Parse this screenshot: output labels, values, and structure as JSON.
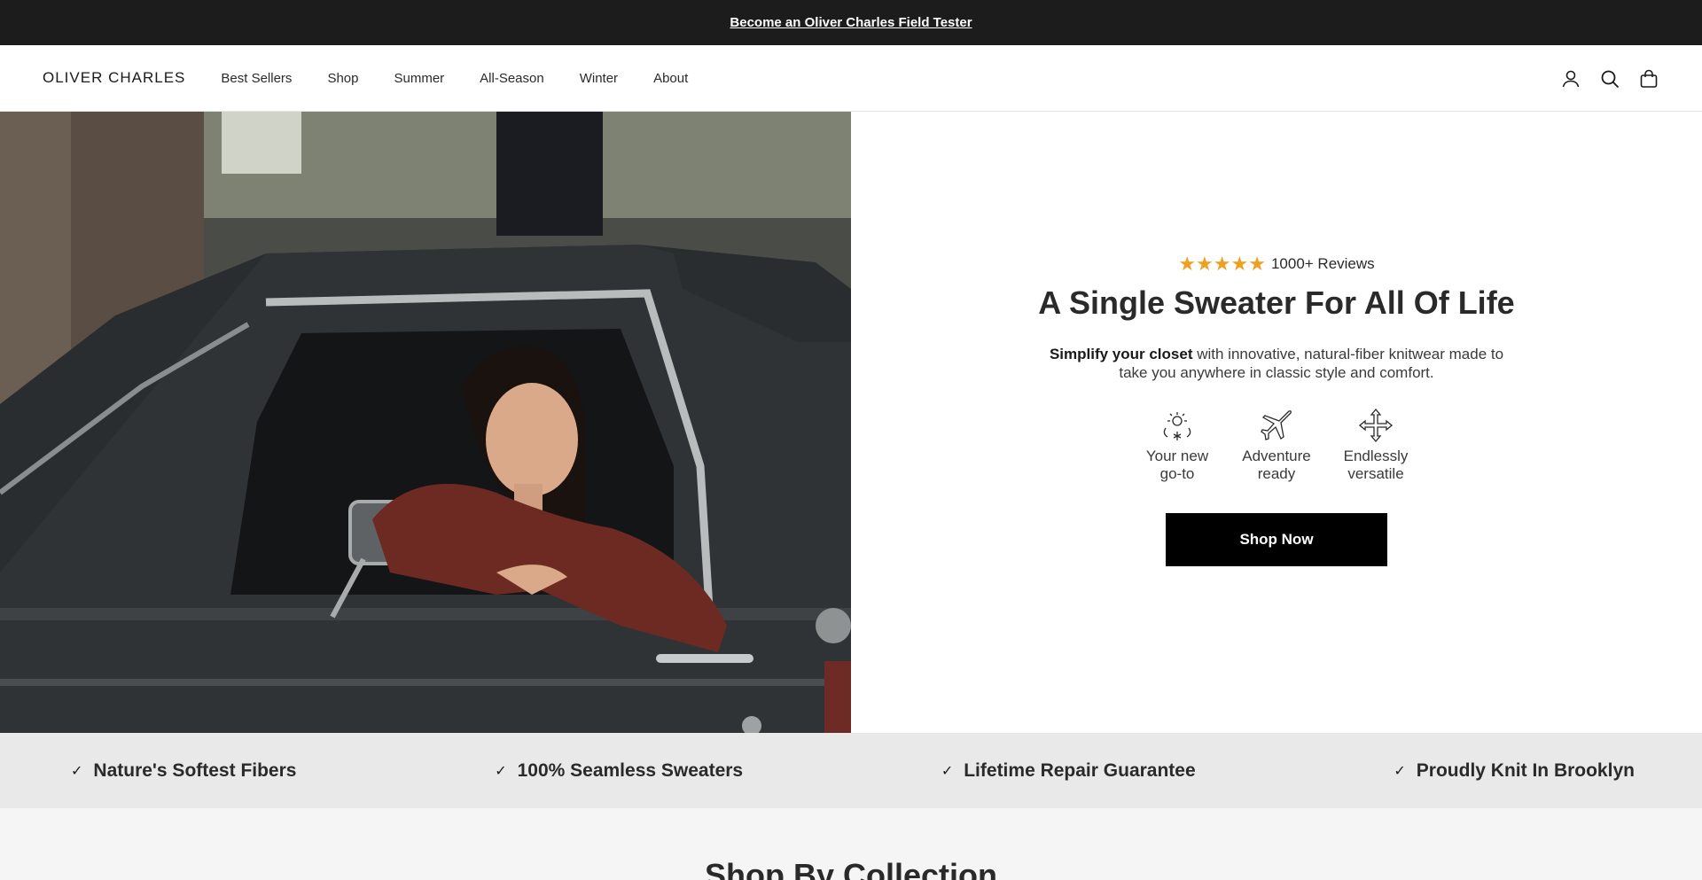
{
  "announcement": {
    "text": "Become an Oliver Charles Field Tester"
  },
  "header": {
    "logo": "OLIVER CHARLES",
    "nav": [
      "Best Sellers",
      "Shop",
      "Summer",
      "All-Season",
      "Winter",
      "About"
    ],
    "icons": [
      "account-icon",
      "search-icon",
      "cart-icon"
    ]
  },
  "hero": {
    "stars": "★★★★★",
    "rating_count": 5,
    "reviews": "1000+ Reviews",
    "title": "A Single Sweater For All Of Life",
    "desc_bold": "Simplify your closet",
    "desc_rest": " with innovative, natural-fiber knitwear made to take you anywhere in classic style and comfort.",
    "features": [
      {
        "icon": "sun-snow-icon",
        "label": "Your new go-to"
      },
      {
        "icon": "airplane-icon",
        "label": "Adventure ready"
      },
      {
        "icon": "arrows-icon",
        "label": "Endlessly versatile"
      }
    ],
    "cta": "Shop Now",
    "star_color": "#f0a020"
  },
  "benefits": [
    "Nature's Softest Fibers",
    "100% Seamless Sweaters",
    "Lifetime Repair Guarantee",
    "Proudly Knit In Brooklyn"
  ],
  "collections": {
    "title": "Shop By Collection"
  }
}
